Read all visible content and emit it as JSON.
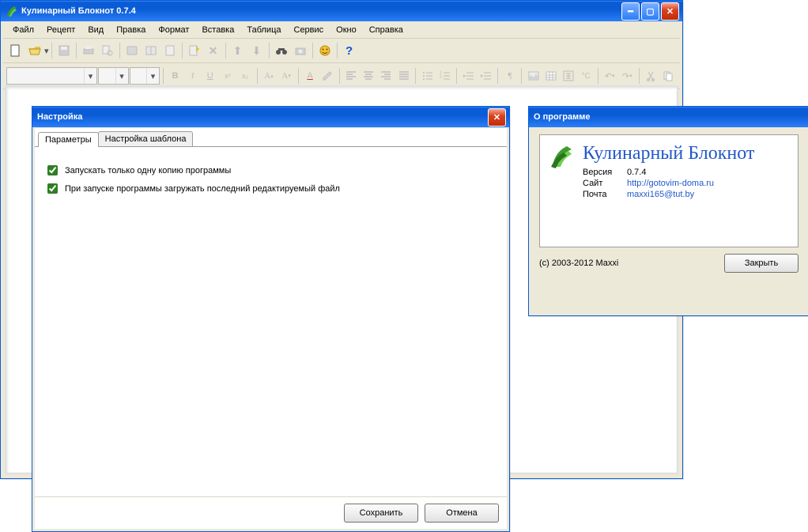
{
  "main": {
    "title": "Кулинарный Блокнот 0.7.4",
    "menu": [
      "Файл",
      "Рецепт",
      "Вид",
      "Правка",
      "Формат",
      "Вставка",
      "Таблица",
      "Сервис",
      "Окно",
      "Справка"
    ]
  },
  "settings": {
    "title": "Настройка",
    "tabs": [
      "Параметры",
      "Настройка шаблона"
    ],
    "opt1": "Запускать только одну копию программы",
    "opt2": "При запуске программы загружать последний редактируемый файл",
    "save": "Сохранить",
    "cancel": "Отмена"
  },
  "about": {
    "title": "О программе",
    "app": "Кулинарный Блокнот",
    "version_label": "Версия",
    "version": "0.7.4",
    "site_label": "Сайт",
    "site": "http://gotovim-doma.ru",
    "mail_label": "Почта",
    "mail": "maxxi165@tut.by",
    "copyright": "(c) 2003-2012 Maxxi",
    "close": "Закрыть"
  }
}
